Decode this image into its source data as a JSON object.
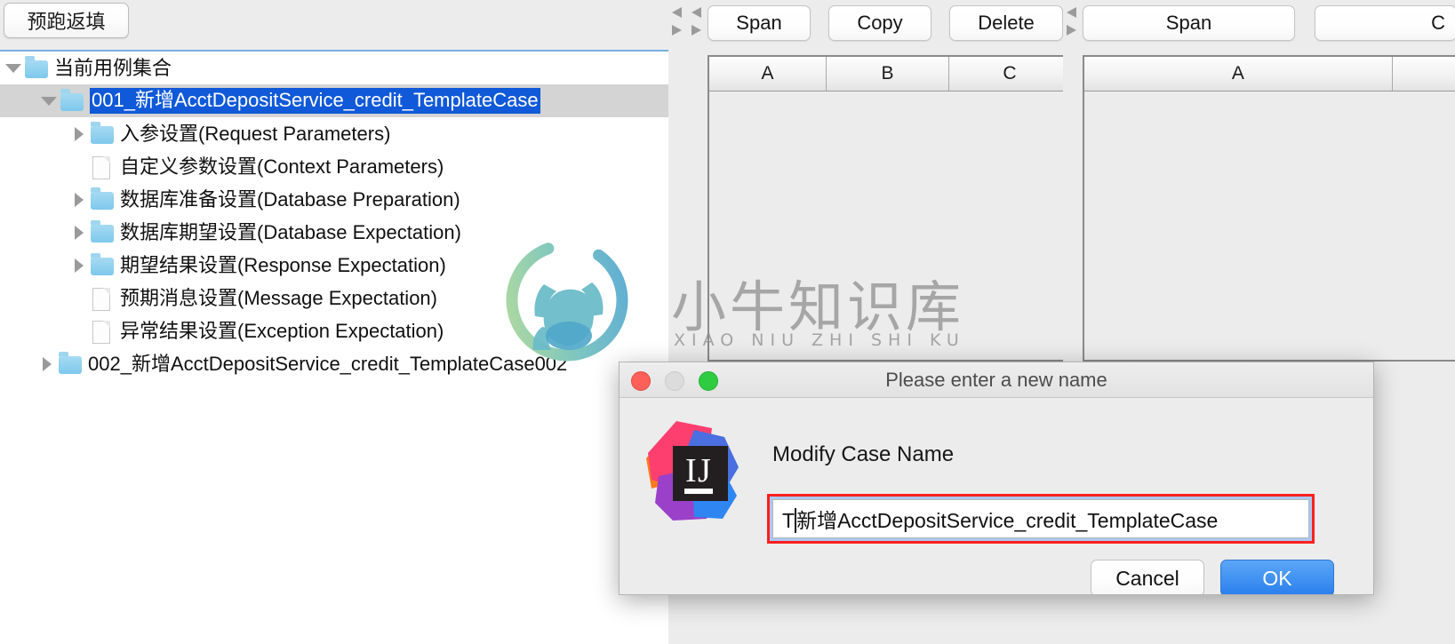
{
  "left_panel": {
    "toolbar": {
      "prerun_button_label": "预跑返填"
    },
    "tree": {
      "root_label": "当前用例集合",
      "items": [
        {
          "label": "001_新增AcctDepositService_credit_TemplateCase",
          "icon": "folder-icon",
          "toggle": "expanded",
          "depth": 1,
          "selected": true
        },
        {
          "label": "入参设置(Request Parameters)",
          "icon": "folder-icon",
          "toggle": "collapsed",
          "depth": 2,
          "selected": false
        },
        {
          "label": "自定义参数设置(Context Parameters)",
          "icon": "file-icon",
          "toggle": "none",
          "depth": 2,
          "selected": false
        },
        {
          "label": "数据库准备设置(Database Preparation)",
          "icon": "folder-icon",
          "toggle": "collapsed",
          "depth": 2,
          "selected": false
        },
        {
          "label": "数据库期望设置(Database Expectation)",
          "icon": "folder-icon",
          "toggle": "collapsed",
          "depth": 2,
          "selected": false
        },
        {
          "label": "期望结果设置(Response Expectation)",
          "icon": "folder-icon",
          "toggle": "collapsed",
          "depth": 2,
          "selected": false
        },
        {
          "label": "预期消息设置(Message Expectation)",
          "icon": "file-icon",
          "toggle": "none",
          "depth": 2,
          "selected": false
        },
        {
          "label": "异常结果设置(Exception Expectation)",
          "icon": "file-icon",
          "toggle": "none",
          "depth": 2,
          "selected": false
        },
        {
          "label": "002_新增AcctDepositService_credit_TemplateCase002",
          "icon": "folder-icon",
          "toggle": "collapsed",
          "depth": 1,
          "selected": false
        }
      ]
    }
  },
  "middle_panel": {
    "toolbar_buttons": [
      "Span",
      "Copy",
      "Delete"
    ],
    "grid": {
      "columns": [
        "A",
        "B",
        "C"
      ],
      "rows": []
    }
  },
  "right_panel": {
    "toolbar_buttons": [
      "Span",
      "C"
    ],
    "grid": {
      "columns": [
        "A"
      ],
      "rows": []
    }
  },
  "watermark": {
    "text_cn": "小牛知识库",
    "text_en": "XIAO NIU ZHI SHI KU"
  },
  "dialog": {
    "title": "Please enter a new name",
    "message": "Modify Case Name",
    "input": {
      "value_before_caret": "T",
      "value_after_caret": "新增AcctDepositService_credit_TemplateCase",
      "placeholder": ""
    },
    "cancel_label": "Cancel",
    "ok_label": "OK",
    "traffic_lights": [
      "close",
      "minimize",
      "maximize"
    ],
    "app_icon": "intellij-idea-icon",
    "highlight_color": "#ff1f1f"
  }
}
